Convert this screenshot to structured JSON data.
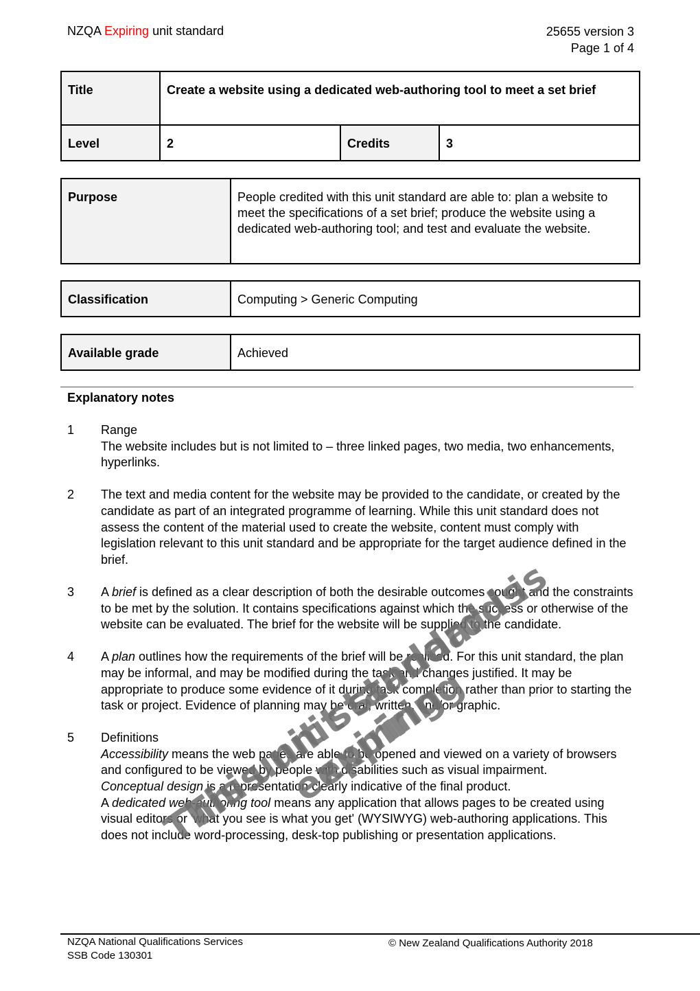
{
  "header": {
    "prefix": "NZQA",
    "status": "Expiring",
    "suffix": "unit standard",
    "unit_version": "25655 version 3",
    "page": "Page 1 of 4"
  },
  "title_table": {
    "title_label": "Title",
    "title_value": "Create a website using a dedicated web-authoring tool to meet a set brief",
    "level_label": "Level",
    "level_value": "2",
    "credits_label": "Credits",
    "credits_value": "3"
  },
  "purpose": {
    "label": "Purpose",
    "value": "People credited with this unit standard are able to: plan a website to meet the specifications of a set brief; produce the website using a dedicated web-authoring tool; and test and evaluate the website."
  },
  "classification": {
    "label": "Classification",
    "value": "Computing > Generic Computing"
  },
  "grade": {
    "label": "Available grade",
    "value": "Achieved"
  },
  "explanatory": {
    "title": "Explanatory notes",
    "notes": [
      {
        "num": "1",
        "heading": "Range",
        "text": "The website includes but is not limited to – three linked pages, two media, two enhancements, hyperlinks."
      },
      {
        "num": "2",
        "text": "The text and media content for the website may be provided to the candidate, or created by the candidate as part of an integrated programme of learning.  While this unit standard does not assess the content of the material used to create the website, content must comply with legislation relevant to this unit standard and be appropriate for the target audience defined in the brief."
      },
      {
        "num": "3",
        "pre": "A ",
        "term": "brief",
        "text": " is defined as a clear description of both the desirable outcomes sought and the constraints to be met by the solution.  It contains specifications against which the success or otherwise of the website can be evaluated.  The brief for the website will be supplied to the candidate."
      },
      {
        "num": "4",
        "pre": "A ",
        "term": "plan",
        "text": " outlines how the requirements of the brief will be realised.  For this unit standard, the plan may be informal, and may be modified during the task and changes justified.  It may be appropriate to produce some evidence of it during task completion rather than prior to starting the task or project.  Evidence of planning may be oral, written, and/or graphic."
      },
      {
        "num": "5",
        "heading": "Definitions",
        "definitions": [
          {
            "pre": "",
            "term": "Accessibility",
            "text": " means the web pages are able to be opened and viewed on a variety of browsers and configured to be viewed by people with disabilities such as visual impairment."
          },
          {
            "pre": "",
            "term": "Conceptual design",
            "text": " is a representation clearly indicative of the final product."
          },
          {
            "pre": "A ",
            "term": "dedicated web-authoring tool",
            "text": " means any application that allows pages to be created using visual editors or 'what you see is what you get' (WYSIWYG) web-authoring applications.  This does not include word-processing, desk-top publishing or presentation applications."
          }
        ]
      }
    ]
  },
  "watermark": {
    "line1": "This unit standard is",
    "line2": "expiring"
  },
  "footer": {
    "org": "NZQA National Qualifications Services",
    "ssb": "SSB Code 130301",
    "copyright": "© New Zealand Qualifications Authority 2018"
  }
}
